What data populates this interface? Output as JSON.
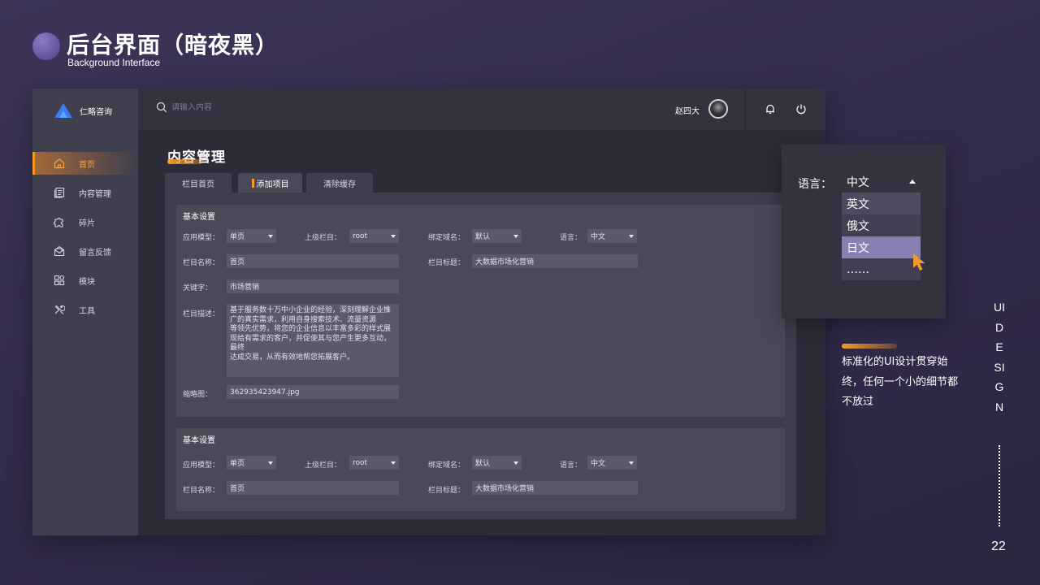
{
  "slide": {
    "title": "后台界面（暗夜黑）",
    "subtitle": "Background Interface",
    "page_number": "22",
    "vertical_text": "UI DESIGN",
    "note": "标准化的UI设计贯穿始终，任何一个小的细节都不放过"
  },
  "app": {
    "logo_text": "仁略咨询",
    "search_placeholder": "请输入内容",
    "user_name": "赵四大",
    "sidebar": {
      "items": [
        {
          "label": "首页",
          "icon": "home-icon",
          "active": true
        },
        {
          "label": "内容管理",
          "icon": "content-icon",
          "active": false
        },
        {
          "label": "碎片",
          "icon": "puzzle-icon",
          "active": false
        },
        {
          "label": "留言反馈",
          "icon": "message-icon",
          "active": false
        },
        {
          "label": "模块",
          "icon": "modules-icon",
          "active": false
        },
        {
          "label": "工具",
          "icon": "tools-icon",
          "active": false
        }
      ]
    },
    "page_title": "内容管理",
    "tabs": [
      {
        "label": "栏目首页",
        "active": false
      },
      {
        "label": "添加项目",
        "active": true
      },
      {
        "label": "清除缓存",
        "active": false
      }
    ],
    "card1": {
      "title": "基本设置",
      "app_model_label": "应用模型：",
      "app_model_value": "单页",
      "parent_label": "上级栏目：",
      "parent_value": "root",
      "domain_label": "绑定域名：",
      "domain_value": "默认",
      "lang_label": "语言：",
      "lang_value": "中文",
      "name_label": "栏目名称：",
      "name_value": "首页",
      "col_title_label": "栏目标题：",
      "col_title_value": "大数据市场化营销",
      "keyword_label": "关键字：",
      "keyword_value": "市场营销",
      "desc_label": "栏目描述：",
      "desc_value": "基于服务数十万中小企业的经验，深刻理解企业推广的真实需求，利用自身搜索技术、流量资源\n等领先优势，将您的企业信息以丰富多彩的样式展现给有需求的客户，并促使其与您产生更多互动，最终\n达成交易，从而有效地帮您拓展客户。",
      "thumb_label": "缩略图：",
      "thumb_value": "362935423947.jpg"
    },
    "card2": {
      "title": "基本设置",
      "app_model_label": "应用模型：",
      "app_model_value": "单页",
      "parent_label": "上级栏目：",
      "parent_value": "root",
      "domain_label": "绑定域名：",
      "domain_value": "默认",
      "lang_label": "语言：",
      "lang_value": "中文",
      "name_label": "栏目名称：",
      "name_value": "首页",
      "col_title_label": "栏目标题：",
      "col_title_value": "大数据市场化营销"
    }
  },
  "dropdown": {
    "label": "语言：",
    "selected": "中文",
    "options": [
      "英文",
      "俄文",
      "日文",
      "……"
    ],
    "hover_index": 2
  },
  "colors": {
    "accent": "#f59a2a",
    "highlight": "#8a7fb3"
  }
}
